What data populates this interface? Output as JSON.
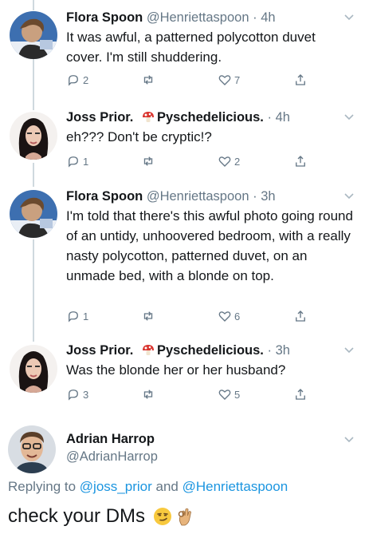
{
  "tweets": [
    {
      "name": "Flora Spoon",
      "handle": "@Henriettaspoon",
      "time": "4h",
      "text": "It was awful, a patterned polycotton duvet cover. I'm still shuddering.",
      "replies": "2",
      "retweets": "",
      "likes": "7"
    },
    {
      "name": "Joss Prior.",
      "name_suffix": "Pyschedelicious.",
      "time": "4h",
      "text": "eh??? Don't be cryptic!?",
      "replies": "1",
      "retweets": "",
      "likes": "2"
    },
    {
      "name": "Flora Spoon",
      "handle": "@Henriettaspoon",
      "time": "3h",
      "text": "I'm told that there's this awful photo going round of an untidy, unhoovered bedroom, with a really nasty polycotton, patterned duvet, on an unmade bed, with a blonde on top.",
      "replies": "1",
      "retweets": "",
      "likes": "6"
    },
    {
      "name": "Joss Prior.",
      "name_suffix": "Pyschedelicious.",
      "time": "3h",
      "text": "Was the blonde her or her husband?",
      "replies": "3",
      "retweets": "",
      "likes": "5"
    }
  ],
  "main_tweet": {
    "name": "Adrian Harrop",
    "handle": "@AdrianHarrop",
    "replying_prefix": "Replying to",
    "replying_to_1": "@joss_prior",
    "replying_and": "and",
    "replying_to_2": "@Henriettaspoon",
    "text": "check your DMs"
  },
  "icons": {
    "reply": "reply-icon",
    "retweet": "retweet-icon",
    "like": "heart-icon",
    "share": "share-icon",
    "chevron": "chevron-down-icon",
    "mushroom": "mushroom-emoji",
    "smirk": "smirking-face-emoji",
    "ok_hand": "ok-hand-emoji"
  },
  "colors": {
    "text": "#14171a",
    "secondary": "#657786",
    "link": "#1b95e0",
    "thread_line": "#cfd9de"
  }
}
